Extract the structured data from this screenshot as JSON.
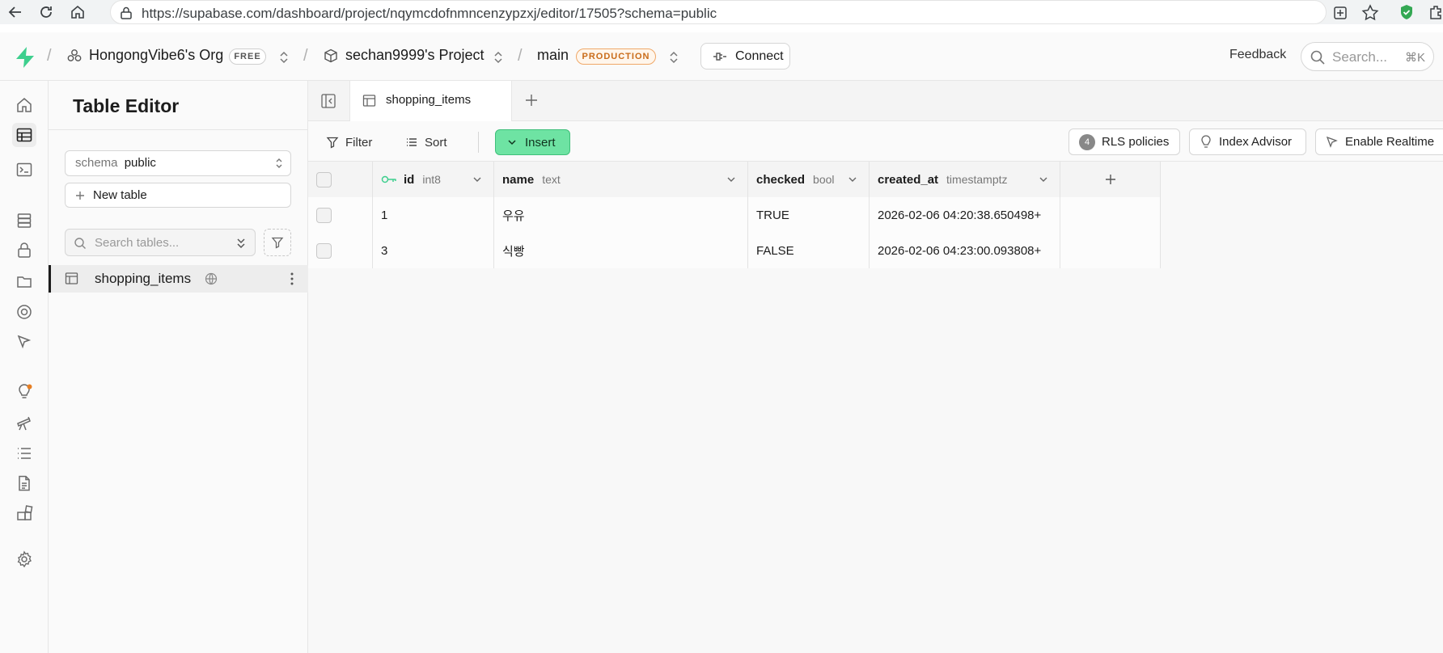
{
  "browser": {
    "url": "https://supabase.com/dashboard/project/nqymcdofnmncenzypzxj/editor/17505?schema=public"
  },
  "header": {
    "org_name": "HongongVibe6's Org",
    "org_badge": "FREE",
    "project_name": "sechan9999's Project",
    "branch_name": "main",
    "branch_badge": "PRODUCTION",
    "connect_label": "Connect",
    "feedback_label": "Feedback",
    "search_placeholder": "Search...",
    "search_shortcut": "⌘K"
  },
  "sidebar": {
    "title": "Table Editor",
    "schema_label": "schema",
    "schema_value": "public",
    "new_table_label": "New table",
    "search_placeholder": "Search tables...",
    "tables": [
      {
        "name": "shopping_items"
      }
    ]
  },
  "tabs": [
    {
      "label": "shopping_items",
      "active": true
    }
  ],
  "toolbar": {
    "filter_label": "Filter",
    "sort_label": "Sort",
    "insert_label": "Insert",
    "rls_count": "4",
    "rls_label": "RLS policies",
    "index_advisor_label": "Index Advisor",
    "realtime_label": "Enable Realtime"
  },
  "grid": {
    "columns": [
      {
        "name": "id",
        "type": "int8",
        "primary_key": true
      },
      {
        "name": "name",
        "type": "text"
      },
      {
        "name": "checked",
        "type": "bool"
      },
      {
        "name": "created_at",
        "type": "timestamptz"
      }
    ],
    "rows": [
      {
        "id": "1",
        "name": "우유",
        "checked": "TRUE",
        "created_at": "2026-02-06 04:20:38.650498+"
      },
      {
        "id": "3",
        "name": "식빵",
        "checked": "FALSE",
        "created_at": "2026-02-06 04:23:00.093808+"
      }
    ]
  },
  "colors": {
    "brand_green": "#3ecf8e",
    "insert_green": "#6ee3a3",
    "production_orange": "#c96c1a"
  }
}
